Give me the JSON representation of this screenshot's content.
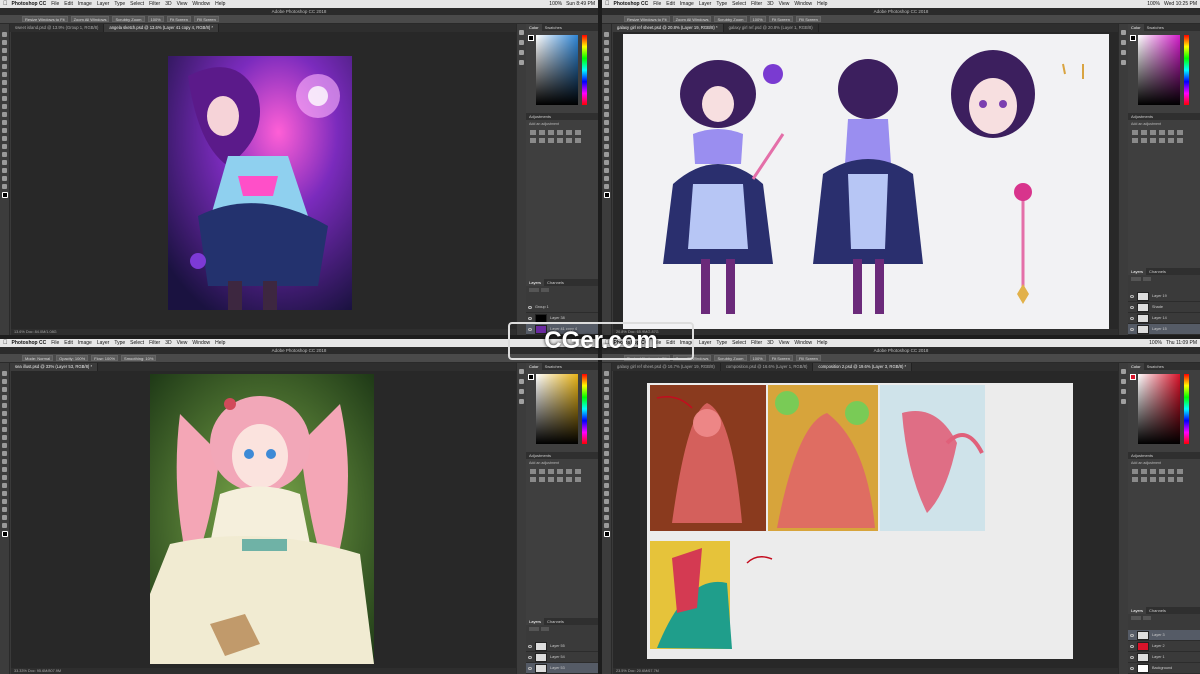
{
  "menubar_items": [
    "File",
    "Edit",
    "Image",
    "Layer",
    "Type",
    "Select",
    "Filter",
    "3D",
    "View",
    "Window",
    "Help"
  ],
  "quads": [
    {
      "app": "Photoshop CC",
      "clock": "Sun 8:49 PM",
      "battery": "100%",
      "title": "Adobe Photoshop CC 2018",
      "opts": [
        "Resize Windows to Fit",
        "Zoom All Windows",
        "Scrubby Zoom",
        "100%",
        "Fit Screen",
        "Fill Screen"
      ],
      "tabs": [
        "sweet island.psd @ 13.9% (Group 1, RGB/8)",
        "angela sketch.psd @ 13.6% (Layer 41 copy 4, RGB/8) *"
      ],
      "status": "13.6%    Doc: 84.0M/1.08G",
      "panel_tabs": [
        "Color",
        "Swatches"
      ],
      "adjustments": "Adjustments",
      "adjust_sub": "Add an adjustment",
      "layer_tabs": [
        "Layers",
        "Channels"
      ],
      "layers": [
        "Group 1",
        "Layer 38",
        "Layer 41 copy 4"
      ],
      "picker_hue": "#2f86d6"
    },
    {
      "app": "Photoshop CC",
      "clock": "Wed 10:25 PM",
      "battery": "100%",
      "title": "Adobe Photoshop CC 2018",
      "opts": [
        "Resize Windows to Fit",
        "Zoom All Windows",
        "Scrubby Zoom",
        "100%",
        "Fit Screen",
        "Fill Screen"
      ],
      "tabs": [
        "galaxy girl ref sheet.psd @ 20.8% (Layer 19, RGB/8) *",
        "galaxy girl ref.psd @ 20.8% (Layer 1, RGB/8)"
      ],
      "status": "20.8%    Doc: 65.9M/2.87G",
      "panel_tabs": [
        "Color",
        "Swatches"
      ],
      "adjustments": "Adjustments",
      "adjust_sub": "Add an adjustment",
      "layer_tabs": [
        "Layers",
        "Channels"
      ],
      "layers": [
        "Layer 19",
        "Shade",
        "Layer 14",
        "Layer 15"
      ],
      "picker_hue": "#d21ec9"
    },
    {
      "app": "Photoshop CC",
      "clock": "",
      "battery": "",
      "title": "Adobe Photoshop CC 2018",
      "opts": [
        "Mode: Normal",
        "Opacity: 100%",
        "Flow: 100%",
        "Smoothing: 10%"
      ],
      "tabs": [
        "sea illust.psd @ 33% (Layer 53, RGB/8) *"
      ],
      "status": "33.33%    Doc: 95.6M/807.9M",
      "panel_tabs": [
        "Color",
        "Swatches"
      ],
      "adjustments": "Adjustments",
      "adjust_sub": "Add an adjustment",
      "layer_tabs": [
        "Layers",
        "Channels"
      ],
      "layers": [
        "Layer 55",
        "Layer 54",
        "Layer 53"
      ],
      "picker_hue": "#e8b418"
    },
    {
      "app": "Photoshop CC",
      "clock": "Thu 11:09 PM",
      "battery": "100%",
      "title": "Adobe Photoshop CC 2018",
      "opts": [
        "Resize Windows to Fit",
        "Zoom All Windows",
        "Scrubby Zoom",
        "100%",
        "Fit Screen",
        "Fill Screen"
      ],
      "tabs": [
        "galaxy girl ref sheet.psd @ 16.7% (Layer 19, RGB/8)",
        "composition.psd @ 16.6% (Layer 1, RGB/8)",
        "composition 2.psd @ 19.6% (Layer 3, RGB/8) *"
      ],
      "status": "23.5%    Doc: 20.6M/67.7M",
      "panel_tabs": [
        "Color",
        "Swatches"
      ],
      "adjustments": "Adjustments",
      "adjust_sub": "Add an adjustment",
      "layer_tabs": [
        "Layers",
        "Channels"
      ],
      "layers": [
        "Layer 3",
        "Layer 2",
        "Layer 1",
        "Background"
      ],
      "picker_hue": "#d8132a"
    }
  ],
  "watermark": "CGer.com"
}
